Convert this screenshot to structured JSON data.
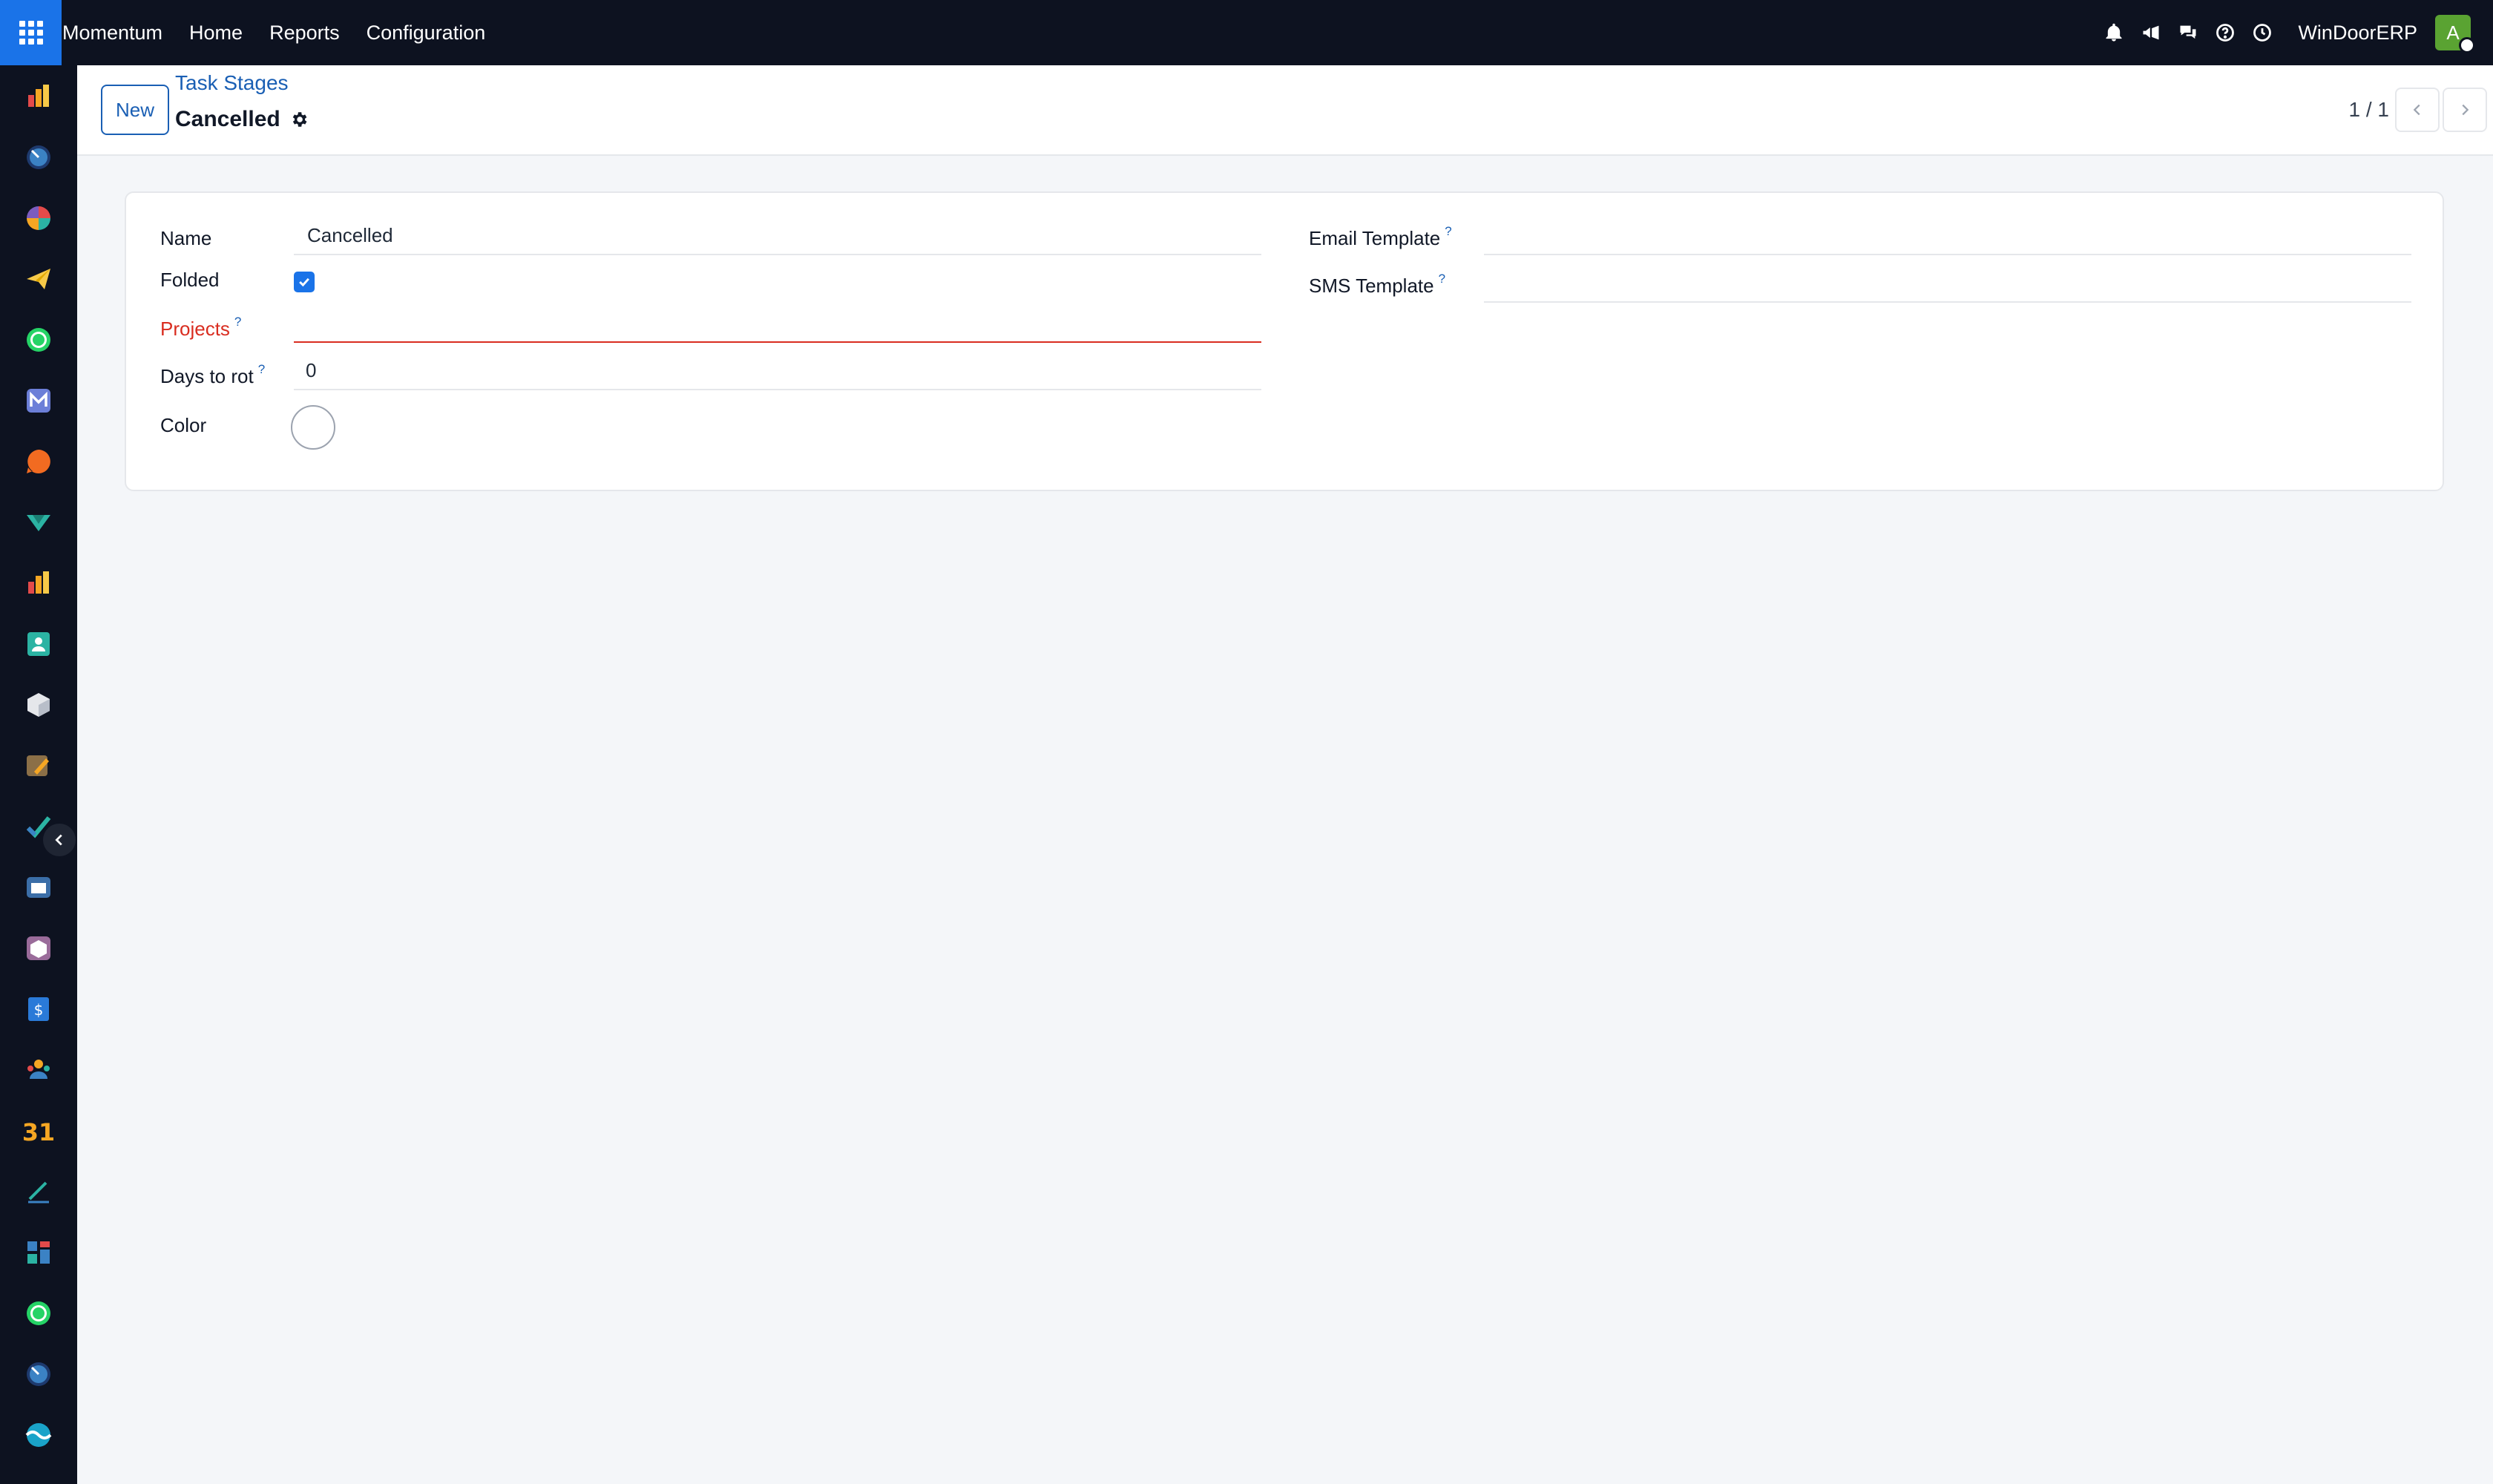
{
  "topbar": {
    "app_name": "Momentum",
    "menu": [
      "Home",
      "Reports",
      "Configuration"
    ],
    "company": "WinDoorERP",
    "avatar_initial": "A",
    "icons": [
      "bell-icon",
      "megaphone-icon",
      "chat-icon",
      "help-icon",
      "clock-icon"
    ]
  },
  "sidebar": {
    "apps": [
      "dashboard",
      "clock",
      "pie-chart",
      "send",
      "whatsapp",
      "mail",
      "chat-bubble",
      "check-down",
      "bar-chart",
      "contacts",
      "box",
      "pencil",
      "task-check",
      "book",
      "package",
      "invoice",
      "team",
      "calendar",
      "sign",
      "widgets",
      "whatsapp",
      "clock",
      "wave"
    ]
  },
  "control": {
    "new_label": "New",
    "breadcrumb": "Task Stages",
    "title": "Cancelled",
    "pager": "1 / 1"
  },
  "form": {
    "name_label": "Name",
    "name_value": "Cancelled",
    "folded_label": "Folded",
    "folded_checked": true,
    "projects_label": "Projects",
    "projects_value": "",
    "days_to_rot_label": "Days to rot",
    "days_to_rot_value": "0",
    "color_label": "Color",
    "email_template_label": "Email Template",
    "email_template_value": "",
    "sms_template_label": "SMS Template",
    "sms_template_value": "",
    "help_mark": "?"
  },
  "colors": {
    "topbar_bg": "#0d1220",
    "accent": "#1a73e8",
    "link": "#1a5fb4",
    "required": "#d92d20",
    "avatar_bg": "#5aa332"
  }
}
